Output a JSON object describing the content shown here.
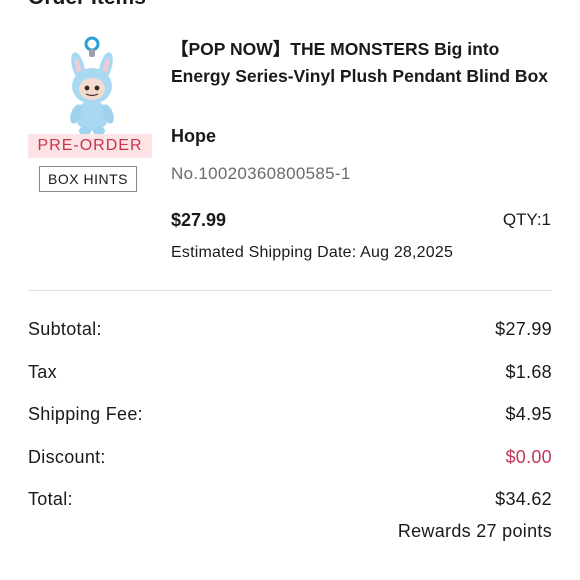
{
  "section": {
    "title": "Order Items"
  },
  "item": {
    "image_icon": "plush-pendant-image",
    "preorder_label": "PRE-ORDER",
    "box_hints_label": "BOX HINTS",
    "title": "【POP NOW】THE MONSTERS Big into Energy Series-Vinyl Plush Pendant Blind Box",
    "variant": "Hope",
    "order_no": "No.10020360800585-1",
    "price": "$27.99",
    "qty": "QTY:1",
    "shipping_date": "Estimated Shipping Date: Aug 28,2025"
  },
  "summary": {
    "subtotal_label": "Subtotal:",
    "subtotal_value": "$27.99",
    "tax_label": "Tax",
    "tax_value": "$1.68",
    "shipping_label": "Shipping Fee:",
    "shipping_value": "$4.95",
    "discount_label": "Discount:",
    "discount_value": "$0.00",
    "total_label": "Total:",
    "total_value": "$34.62",
    "rewards": "Rewards 27 points"
  },
  "colors": {
    "preorder_bg": "#fbe3e6",
    "preorder_text": "#c8354a",
    "discount_text": "#c8355a"
  }
}
